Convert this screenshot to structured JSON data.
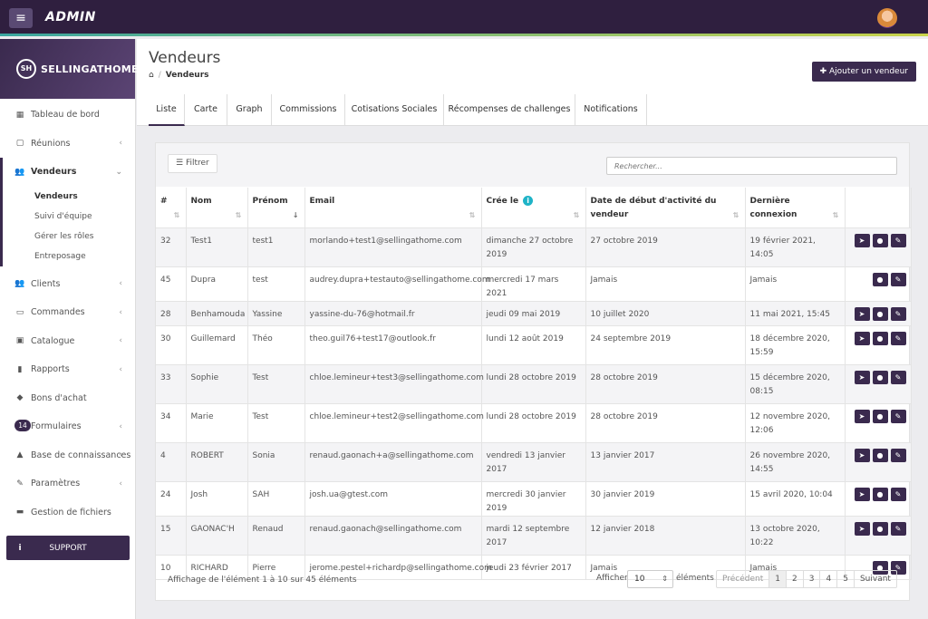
{
  "topbar": {
    "brand": "ADMIN",
    "menu_icon": "hamburger-icon"
  },
  "sidebar": {
    "logo_mark": "SH",
    "logo_text": "SELLINGATHOME",
    "items": [
      {
        "label": "Tableau de bord",
        "icon": "dashboard-icon",
        "chevron": false
      },
      {
        "label": "Réunions",
        "icon": "calendar-icon",
        "chevron": true
      },
      {
        "label": "Vendeurs",
        "icon": "users-icon",
        "chevron": true,
        "active": true
      }
    ],
    "subitems": [
      "Vendeurs",
      "Suivi d'équipe",
      "Gérer les rôles",
      "Entreposage"
    ],
    "items2": [
      {
        "label": "Clients",
        "icon": "users-icon"
      },
      {
        "label": "Commandes",
        "icon": "card-icon"
      },
      {
        "label": "Catalogue",
        "icon": "book-icon"
      },
      {
        "label": "Rapports",
        "icon": "chart-icon"
      },
      {
        "label": "Bons d'achat",
        "icon": "tag-icon"
      },
      {
        "label": "Formulaires",
        "badge": "14"
      },
      {
        "label": "Base de connaissances",
        "icon": "grad-icon"
      },
      {
        "label": "Paramètres",
        "icon": "wrench-icon"
      },
      {
        "label": "Gestion de fichiers",
        "icon": "folder-icon"
      }
    ],
    "support": "SUPPORT"
  },
  "header": {
    "title": "Vendeurs",
    "breadcrumb": "Vendeurs",
    "add_button": "Ajouter un vendeur"
  },
  "tabs": [
    "Liste",
    "Carte",
    "Graph",
    "Commissions",
    "Cotisations Sociales",
    "Récompenses de challenges",
    "Notifications"
  ],
  "toolbar": {
    "filter": "Filtrer",
    "search_placeholder": "Rechercher..."
  },
  "table": {
    "columns": [
      "#",
      "Nom",
      "Prénom",
      "Email",
      "Crée le",
      "Date de début d'activité du vendeur",
      "Dernière connexion"
    ],
    "rows": [
      {
        "id": "32",
        "nom": "Test1",
        "prenom": "test1",
        "email": "morlando+test1@sellingathome.com",
        "cree": "dimanche 27 octobre 2019",
        "debut": "27 octobre 2019",
        "derniere": "19 février 2021, 14:05",
        "buttons": 3
      },
      {
        "id": "45",
        "nom": "Dupra",
        "prenom": "test",
        "email": "audrey.dupra+testauto@sellingathome.com",
        "cree": "mercredi 17 mars 2021",
        "debut": "Jamais",
        "derniere": "Jamais",
        "buttons": 2
      },
      {
        "id": "28",
        "nom": "Benhamouda",
        "prenom": "Yassine",
        "email": "yassine-du-76@hotmail.fr",
        "cree": "jeudi 09 mai 2019",
        "debut": "10 juillet 2020",
        "derniere": "11 mai 2021, 15:45",
        "buttons": 3
      },
      {
        "id": "30",
        "nom": "Guillemard",
        "prenom": "Théo",
        "email": "theo.guil76+test17@outlook.fr",
        "cree": "lundi 12 août 2019",
        "debut": "24 septembre 2019",
        "derniere": "18 décembre 2020, 15:59",
        "buttons": 3
      },
      {
        "id": "33",
        "nom": "Sophie",
        "prenom": "Test",
        "email": "chloe.lemineur+test3@sellingathome.com",
        "cree": "lundi 28 octobre 2019",
        "debut": "28 octobre 2019",
        "derniere": "15 décembre 2020, 08:15",
        "buttons": 3
      },
      {
        "id": "34",
        "nom": "Marie",
        "prenom": "Test",
        "email": "chloe.lemineur+test2@sellingathome.com",
        "cree": "lundi 28 octobre 2019",
        "debut": "28 octobre 2019",
        "derniere": "12 novembre 2020, 12:06",
        "buttons": 3
      },
      {
        "id": "4",
        "nom": "ROBERT",
        "prenom": "Sonia",
        "email": "renaud.gaonach+a@sellingathome.com",
        "cree": "vendredi 13 janvier 2017",
        "debut": "13 janvier 2017",
        "derniere": "26 novembre 2020, 14:55",
        "buttons": 3
      },
      {
        "id": "24",
        "nom": "Josh",
        "prenom": "SAH",
        "email": "josh.ua@gtest.com",
        "cree": "mercredi 30 janvier 2019",
        "debut": "30 janvier 2019",
        "derniere": "15 avril 2020, 10:04",
        "buttons": 3
      },
      {
        "id": "15",
        "nom": "GAONAC'H",
        "prenom": "Renaud",
        "email": "renaud.gaonach@sellingathome.com",
        "cree": "mardi 12 septembre 2017",
        "debut": "12 janvier 2018",
        "derniere": "13 octobre 2020, 10:22",
        "buttons": 3
      },
      {
        "id": "10",
        "nom": "RICHARD",
        "prenom": "Pierre",
        "email": "jerome.pestel+richardp@sellingathome.com",
        "cree": "jeudi 23 février 2017",
        "debut": "Jamais",
        "derniere": "Jamais",
        "buttons": 2
      }
    ]
  },
  "footer": {
    "info": "Affichage de l'élément 1 à 10 sur 45 éléments",
    "show_label": "Afficher",
    "page_size": "10",
    "elements_label": "éléments",
    "pager": [
      "Précédent",
      "1",
      "2",
      "3",
      "4",
      "5",
      "Suivant"
    ],
    "current_page": "1"
  },
  "colors": {
    "brand": "#3a2a4e",
    "topbar": "#2f1f3f",
    "info": "#1fb3c7"
  }
}
